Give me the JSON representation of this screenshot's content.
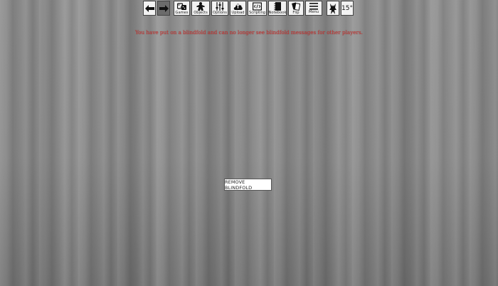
{
  "toolbar": {
    "back_icon": "arrow-left-icon",
    "forward_icon": "arrow-right-icon",
    "games_label": "Games",
    "objects_label": "Objects",
    "options_label": "Options",
    "upload_label": "Upload",
    "scripting_label": "Scripting",
    "notebook_label": "Notebook",
    "flip_label": "Flip",
    "menu_label": "Menu",
    "rotation_value": "15°"
  },
  "message": "You have put on a blindfold and can no longer see blindfold messages for other players.",
  "remove_blindfold_label": "REMOVE BLINDFOLD",
  "colors": {
    "message": "#c8322f",
    "background": "#8a8a8a"
  }
}
